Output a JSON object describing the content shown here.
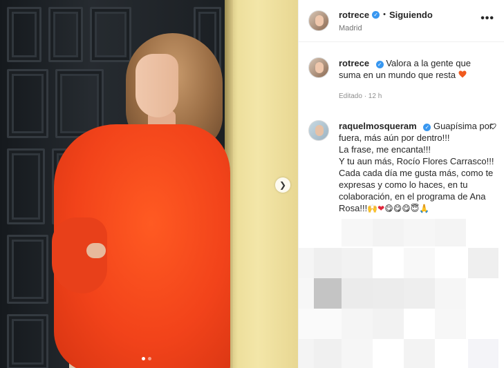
{
  "post": {
    "carousel_index": 1,
    "carousel_count": 2
  },
  "header": {
    "username": "rotrece",
    "separator": "•",
    "follow_label": "Siguiendo",
    "location": "Madrid",
    "more_label": "•••"
  },
  "caption": {
    "username": "rotrece",
    "text": "Valora a la gente que suma en un mundo que resta",
    "meta": "Editado · 12 h"
  },
  "comment": {
    "username": "raquelmosqueram",
    "lines": [
      "Guapísima por fuera, más aún por dentro!!!",
      "La frase, me encanta!!!",
      "Y tu aun más, Rocío Flores Carrasco!!!",
      "Cada cada día me gusta más, como te expresas y como lo haces, en tu colaboración, en el programa de Ana Rosa!!!"
    ],
    "emojis": [
      "🙌",
      "❤",
      "😋",
      "😋",
      "😋",
      "😇",
      "🙏"
    ]
  },
  "colors": {
    "accent_verified": "#3897f0",
    "heart_orange": "#f05a1e",
    "heart_red": "#e0243a",
    "text_primary": "#262626",
    "text_secondary": "#8e8e8e"
  }
}
